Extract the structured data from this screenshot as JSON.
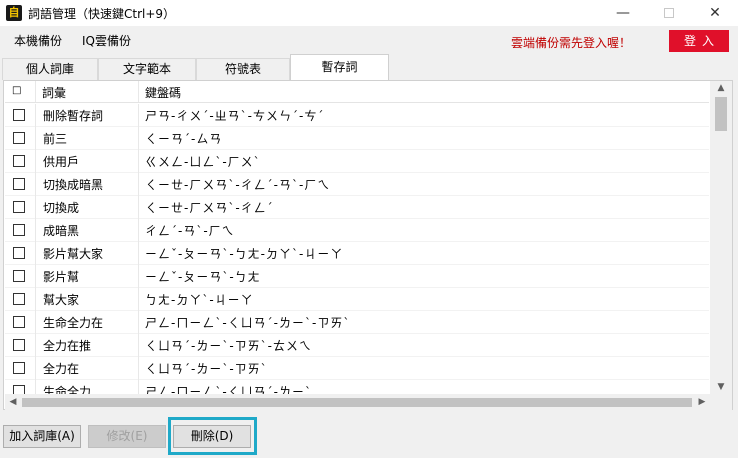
{
  "window": {
    "title": "詞語管理（快速鍵Ctrl+9）",
    "icon_glyph": "自",
    "minimize": "—",
    "close": "✕"
  },
  "menu": {
    "local_backup": "本機備份",
    "iq_backup": "IQ雲備份",
    "cloud_note": "雲端備份需先登入喔！",
    "login": "登入"
  },
  "tabs": [
    {
      "label": "個人詞庫",
      "active": false
    },
    {
      "label": "文字範本",
      "active": false
    },
    {
      "label": "符號表",
      "active": false
    },
    {
      "label": "暫存詞",
      "active": true
    }
  ],
  "table": {
    "check_header": "□",
    "word_header": "詞彙",
    "key_header": "鍵盤碼",
    "rows": [
      {
        "word": "刪除暫存詞",
        "keys": "ㄕㄢ-ㄔㄨˊ-ㄓㄢˋ-ㄘㄨㄣˊ-ㄘˊ"
      },
      {
        "word": "前三",
        "keys": "ㄑㄧㄢˊ-ㄙㄢ"
      },
      {
        "word": "供用戶",
        "keys": "ㄍㄨㄥ-ㄩㄥˋ-ㄏㄨˋ"
      },
      {
        "word": "切換成暗黑",
        "keys": "ㄑㄧㄝ-ㄏㄨㄢˋ-ㄔㄥˊ-ㄢˋ-ㄏㄟ"
      },
      {
        "word": "切換成",
        "keys": "ㄑㄧㄝ-ㄏㄨㄢˋ-ㄔㄥˊ"
      },
      {
        "word": "成暗黑",
        "keys": "ㄔㄥˊ-ㄢˋ-ㄏㄟ"
      },
      {
        "word": "影片幫大家",
        "keys": "ㄧㄥˇ-ㄆㄧㄢˋ-ㄅㄤ-ㄉㄚˋ-ㄐㄧㄚ"
      },
      {
        "word": "影片幫",
        "keys": "ㄧㄥˇ-ㄆㄧㄢˋ-ㄅㄤ"
      },
      {
        "word": "幫大家",
        "keys": "ㄅㄤ-ㄉㄚˋ-ㄐㄧㄚ"
      },
      {
        "word": "生命全力在",
        "keys": "ㄕㄥ-ㄇㄧㄥˋ-ㄑㄩㄢˊ-ㄌㄧˋ-ㄗㄞˋ"
      },
      {
        "word": "全力在推",
        "keys": "ㄑㄩㄢˊ-ㄌㄧˋ-ㄗㄞˋ-ㄊㄨㄟ"
      },
      {
        "word": "全力在",
        "keys": "ㄑㄩㄢˊ-ㄌㄧˋ-ㄗㄞˋ"
      },
      {
        "word": "生命全力",
        "keys": "ㄕㄥ-ㄇㄧㄥˋ-ㄑㄩㄢˊ-ㄌㄧˋ"
      }
    ]
  },
  "buttons": {
    "add": "加入詞庫(A)",
    "edit": "修改(E)",
    "delete": "刪除(D)"
  },
  "scroll": {
    "up": "▲",
    "down": "▼",
    "left": "◀",
    "right": "▶"
  }
}
